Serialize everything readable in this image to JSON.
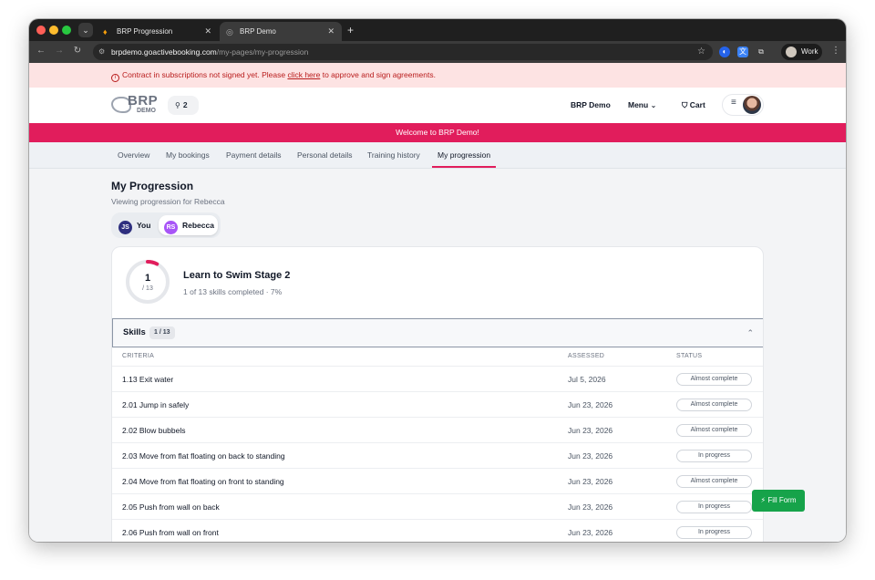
{
  "browser": {
    "tabs": [
      {
        "title": "BRP Progression",
        "active": false
      },
      {
        "title": "BRP Demo",
        "active": true
      }
    ],
    "url_host": "brpdemo.goactivebooking.com",
    "url_path": "/my-pages/my-progression",
    "profile_label": "Work",
    "colors": {
      "close": "#ff5f57",
      "minimize": "#febc2e",
      "zoom": "#28c840"
    }
  },
  "alert": {
    "before": "Contract in subscriptions not signed yet. Please ",
    "link": "click here",
    "after": " to approve and sign agreements."
  },
  "header": {
    "logo_main": "BRP",
    "logo_sub": "DEMO",
    "location_count": "2",
    "site_name": "BRP Demo",
    "menu_label": "Menu",
    "cart_label": "Cart"
  },
  "banner": "Welcome to BRP Demo!",
  "page_tabs": [
    {
      "label": "Overview",
      "active": false
    },
    {
      "label": "My bookings",
      "active": false
    },
    {
      "label": "Payment details",
      "active": false
    },
    {
      "label": "Personal details",
      "active": false
    },
    {
      "label": "Training history",
      "active": false
    },
    {
      "label": "My progression",
      "active": true
    }
  ],
  "main": {
    "title": "My Progression",
    "subtitle": "Viewing progression for Rebecca",
    "people": [
      {
        "initials": "JS",
        "name": "You",
        "color": "#2e2f7f",
        "selected": false
      },
      {
        "initials": "RS",
        "name": "Rebecca",
        "color": "#a855f7",
        "selected": true
      }
    ]
  },
  "course": {
    "completed": 1,
    "total": 13,
    "total_label": "/ 13",
    "title": "Learn to Swim Stage 2",
    "summary": "1 of 13 skills completed · 7%",
    "accent_color": "#e11d5c"
  },
  "skills": {
    "label": "Skills",
    "badge": "1 / 13",
    "columns": {
      "criteria": "CRITERIA",
      "assessed": "ASSESSED",
      "status": "STATUS"
    },
    "rows": [
      {
        "criteria": "1.13 Exit water",
        "assessed": "Jul 5, 2026",
        "status": "Almost complete"
      },
      {
        "criteria": "2.01 Jump in safely",
        "assessed": "Jun 23, 2026",
        "status": "Almost complete"
      },
      {
        "criteria": "2.02 Blow bubbels",
        "assessed": "Jun 23, 2026",
        "status": "Almost complete"
      },
      {
        "criteria": "2.03 Move from flat floating on back to standing",
        "assessed": "Jun 23, 2026",
        "status": "In progress"
      },
      {
        "criteria": "2.04 Move from flat floating on front to standing",
        "assessed": "Jun 23, 2026",
        "status": "Almost complete"
      },
      {
        "criteria": "2.05 Push from wall on back",
        "assessed": "Jun 23, 2026",
        "status": "In progress"
      },
      {
        "criteria": "2.06 Push from wall on front",
        "assessed": "Jun 23, 2026",
        "status": "In progress"
      }
    ]
  },
  "fill_form_label": "Fill Form",
  "fill_form_color": "#16a34a"
}
